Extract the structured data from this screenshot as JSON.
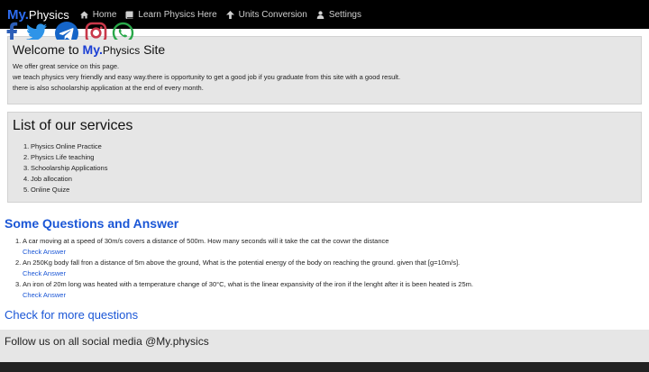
{
  "navbar": {
    "brand_part1": "My.",
    "brand_part2": "Physics",
    "items": [
      {
        "label": "Home",
        "icon": "home-icon"
      },
      {
        "label": "Learn Physics Here",
        "icon": "book-icon"
      },
      {
        "label": "Units Conversion",
        "icon": "arrow-up-icon"
      },
      {
        "label": "Settings",
        "icon": "user-icon"
      }
    ]
  },
  "welcome": {
    "title_prefix": "Welcome to ",
    "title_brand1": "My.",
    "title_brand2": "Physics",
    "title_suffix": " Site",
    "lines": [
      "We offer great service on this page.",
      "we teach physics very friendly and easy way.there is opportunity to get a good job if you graduate from this site with a good result.",
      "there is also schoolarship application at the end of every month."
    ]
  },
  "services": {
    "title": "List of our services",
    "items": [
      "Physics Online Practice",
      "Physics Life teaching",
      "Schoolarship Applications",
      "Job allocation",
      "Online Quize"
    ]
  },
  "questions": {
    "title": "Some Questions and Answer",
    "check_label": "Check Answer",
    "items": [
      "A car moving at a speed of 30m/s covers a distance of 500m. How many seconds will it take the cat the covwr the distance",
      "An 250Kg body fall fron a distance of 5m above the ground, What is the potential energy of the body on reaching the ground. given that [g=10m/s].",
      "An iron of 20m long was heated with a temperature change of 30°C, what is the linear expansivity of the iron if the lenght after it is been heated is 25m."
    ],
    "more_label": "Check for more questions"
  },
  "footer": {
    "follow_text": "Follow us on all social media @My.physics",
    "social": [
      "facebook-icon",
      "twitter-icon",
      "telegram-icon",
      "instagram-icon",
      "whatsapp-icon"
    ]
  },
  "colors": {
    "brand_blue": "#2d6cf0",
    "link_blue": "#1a56d6",
    "panel_gray": "#e6e6e6",
    "navbar_black": "#000000"
  }
}
